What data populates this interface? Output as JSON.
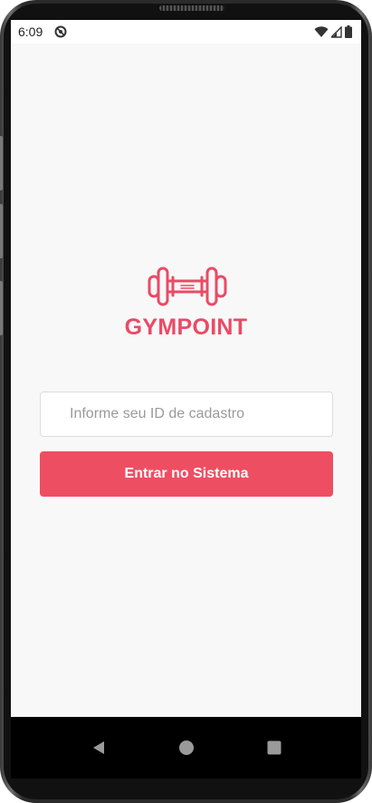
{
  "status_bar": {
    "time": "6:09",
    "icons": [
      "do-not-disturb-icon",
      "wifi-icon",
      "signal-icon",
      "battery-icon"
    ]
  },
  "brand": {
    "logo_icon": "dumbbell-icon",
    "title": "GYMPOINT",
    "accent_color": "#ee4e62"
  },
  "login_form": {
    "id_placeholder": "Informe seu ID de cadastro",
    "id_value": "",
    "submit_label": "Entrar no Sistema"
  },
  "nav_bar": {
    "buttons": [
      "back-icon",
      "home-icon",
      "recents-icon"
    ]
  }
}
